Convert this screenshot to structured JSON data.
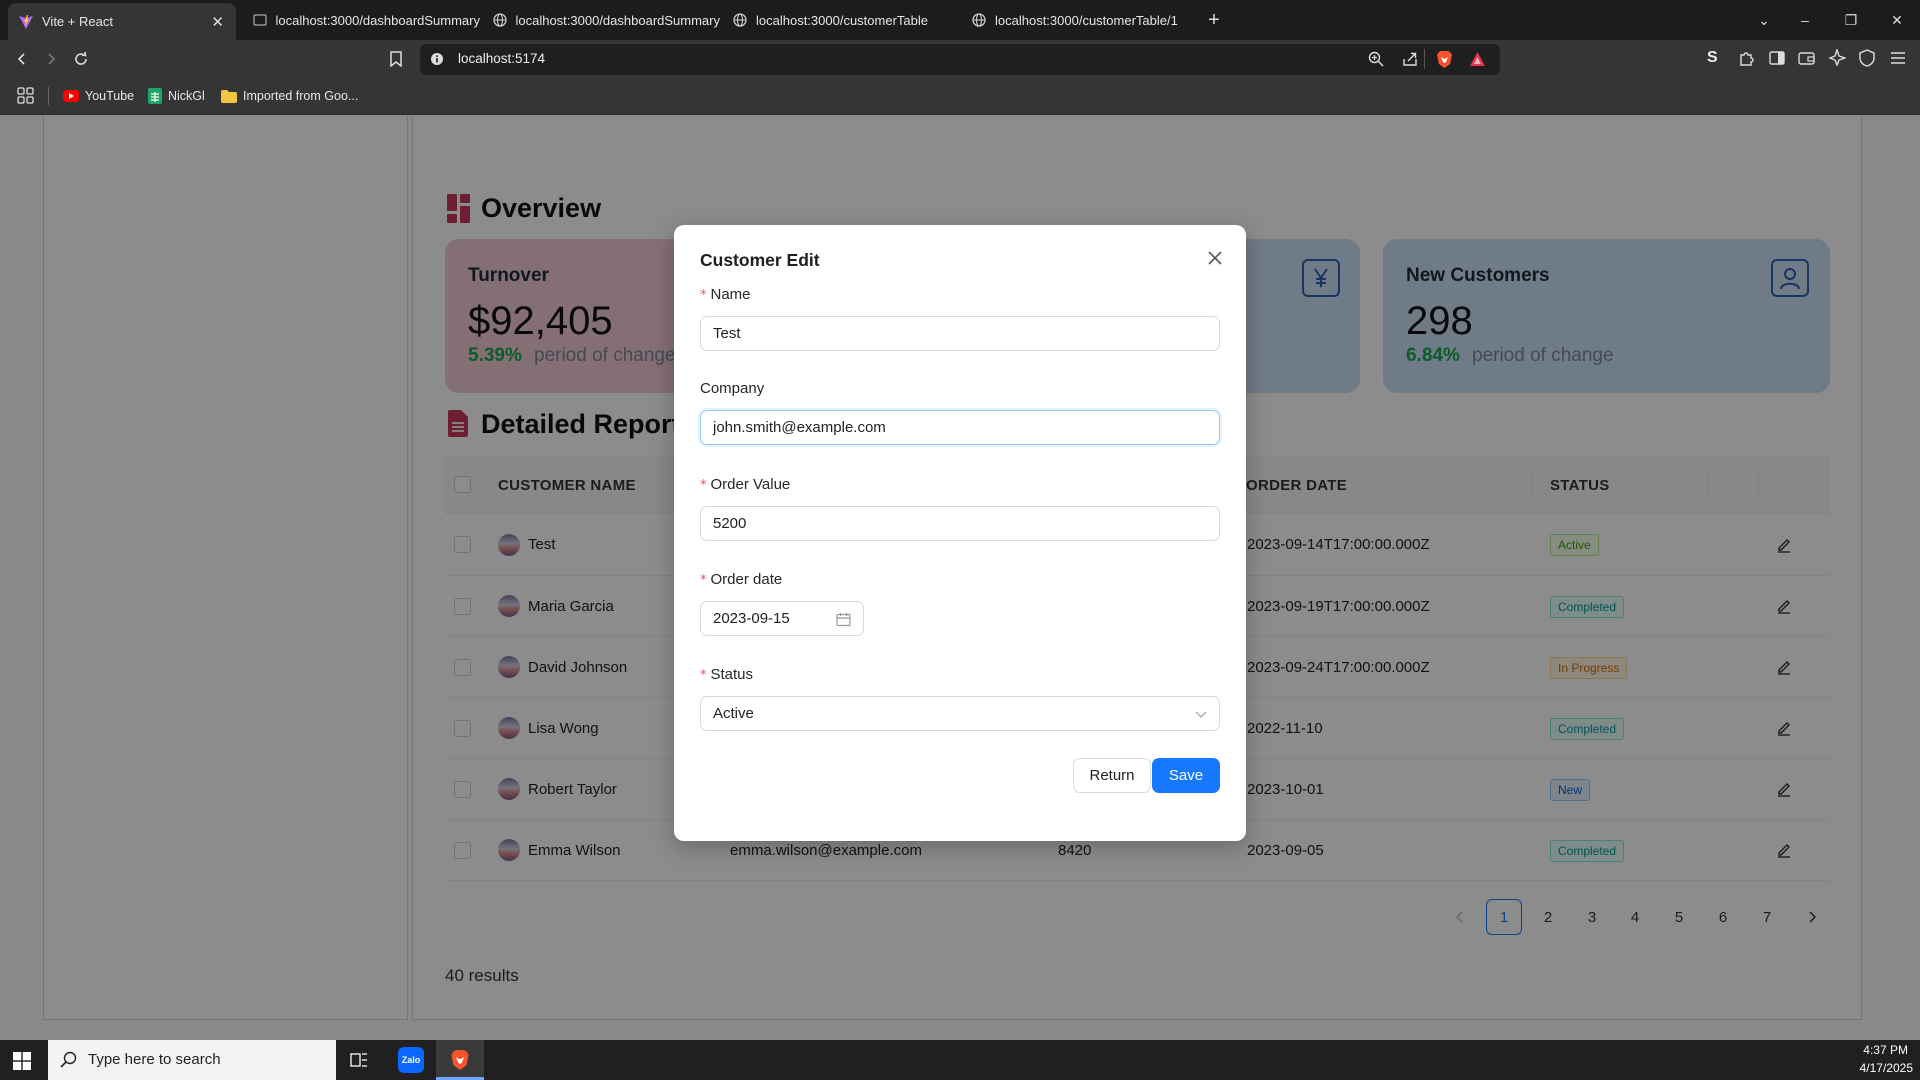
{
  "browser": {
    "tabs": [
      {
        "label": "Vite + React",
        "active": true
      },
      {
        "label": "localhost:3000/dashboardSummary"
      },
      {
        "label": "localhost:3000/dashboardSummary"
      },
      {
        "label": "localhost:3000/customerTable"
      },
      {
        "label": "localhost:3000/customerTable/1"
      }
    ],
    "url": "localhost:5174",
    "bookmarks": [
      {
        "label": "YouTube",
        "icon": "youtube-icon"
      },
      {
        "label": "NickGl",
        "icon": "sheets-icon"
      },
      {
        "label": "Imported from Goo...",
        "icon": "folder-icon"
      }
    ]
  },
  "overview": {
    "title": "Overview",
    "cards": [
      {
        "title": "Turnover",
        "value": "$92,405",
        "pct": "5.39%",
        "period": "period of change",
        "color": "#f1cbd6",
        "icon": "turnover-icon"
      },
      {
        "title": "",
        "value": "",
        "pct": "",
        "period": "",
        "color": "#cde0f7",
        "icon": "yen-icon"
      },
      {
        "title": "New Customers",
        "value": "298",
        "pct": "6.84%",
        "period": "period of change",
        "color": "#cde0f7",
        "icon": "user-icon"
      }
    ]
  },
  "report": {
    "title": "Detailed Report",
    "columns": [
      "CUSTOMER NAME",
      "ORDER DATE",
      "STATUS"
    ],
    "rows": [
      {
        "name": "Test",
        "company": "",
        "value": "",
        "date": "2023-09-14T17:00:00.000Z",
        "status": "Active",
        "status_class": "b-active"
      },
      {
        "name": "Maria Garcia",
        "company": "",
        "value": "",
        "date": "2023-09-19T17:00:00.000Z",
        "status": "Completed",
        "status_class": "b-completed"
      },
      {
        "name": "David Johnson",
        "company": "",
        "value": "",
        "date": "2023-09-24T17:00:00.000Z",
        "status": "In Progress",
        "status_class": "b-progress"
      },
      {
        "name": "Lisa Wong",
        "company": "",
        "value": "",
        "date": "2022-11-10",
        "status": "Completed",
        "status_class": "b-completed"
      },
      {
        "name": "Robert Taylor",
        "company": "",
        "value": "",
        "date": "2023-10-01",
        "status": "New",
        "status_class": "b-new"
      },
      {
        "name": "Emma Wilson",
        "company": "emma.wilson@example.com",
        "value": "8420",
        "date": "2023-09-05",
        "status": "Completed",
        "status_class": "b-completed"
      }
    ],
    "pagination": [
      "1",
      "2",
      "3",
      "4",
      "5",
      "6",
      "7"
    ],
    "current_page": "1",
    "results": "40 results"
  },
  "modal": {
    "title": "Customer Edit",
    "fields": {
      "name": {
        "label": "Name",
        "value": "Test",
        "required": "*"
      },
      "company": {
        "label": "Company",
        "value": "john.smith@example.com"
      },
      "order_value": {
        "label": "Order Value",
        "value": "5200",
        "required": "*"
      },
      "order_date": {
        "label": "Order date",
        "value": "2023-09-15",
        "required": "*"
      },
      "status": {
        "label": "Status",
        "value": "Active",
        "required": "*"
      }
    },
    "return_label": "Return",
    "save_label": "Save"
  },
  "taskbar": {
    "search_placeholder": "Type here to search",
    "time": "4:37 PM",
    "date": "4/17/2025"
  },
  "colors": {
    "accent": "#1677ff",
    "positive": "#13a84a",
    "overview_icon": "#c8385e"
  }
}
